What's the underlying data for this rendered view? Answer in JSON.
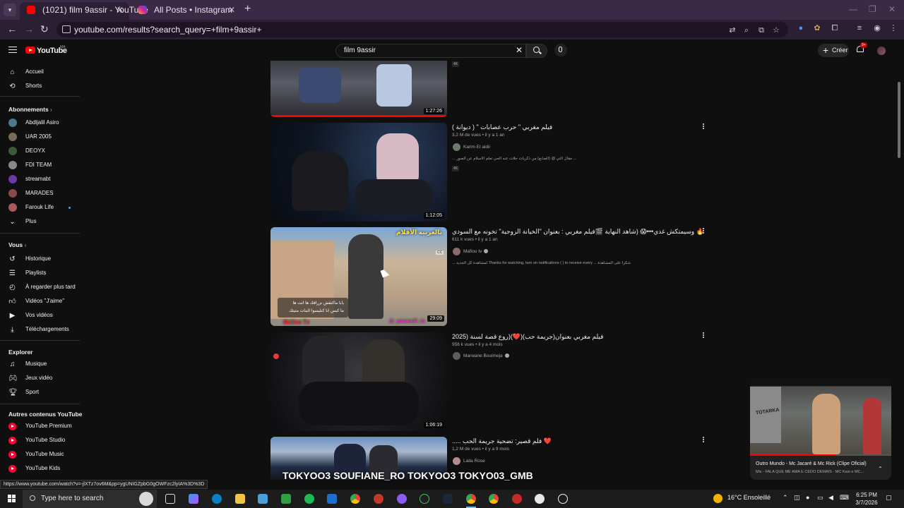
{
  "browser": {
    "tabs": [
      {
        "title": "(1021) film 9assir - YouTube",
        "favicon": "youtube-icon",
        "active": true
      },
      {
        "title": "All Posts • Instagram",
        "favicon": "instagram-icon",
        "active": false
      }
    ],
    "url": "youtube.com/results?search_query=+film+9assir+"
  },
  "youtube": {
    "logo_text": "YouTube",
    "region": "MA",
    "search_query": "film 9assir",
    "create_label": "Créer",
    "notification_count": "9+"
  },
  "sidebar": {
    "main": [
      {
        "label": "Accueil",
        "icon": "home-icon"
      },
      {
        "label": "Shorts",
        "icon": "shorts-icon"
      }
    ],
    "subscriptions_title": "Abonnements",
    "subscriptions": [
      {
        "label": "Abdljalil Asiro",
        "color": "#4a7a8c"
      },
      {
        "label": "UAR 2005",
        "color": "#7a6a5a"
      },
      {
        "label": "DEOYX",
        "color": "#3a5a3a"
      },
      {
        "label": "FDI TEAM",
        "color": "#888888"
      },
      {
        "label": "streamabt",
        "color": "#6a3aa8"
      },
      {
        "label": "MARADES",
        "color": "#8a4a4a"
      },
      {
        "label": "Farouk Life",
        "color": "#a85a5a"
      },
      {
        "label": "Plus",
        "color": ""
      }
    ],
    "you_title": "Vous",
    "you": [
      {
        "label": "Historique",
        "icon": "history-icon"
      },
      {
        "label": "Playlists",
        "icon": "playlist-icon"
      },
      {
        "label": "À regarder plus tard",
        "icon": "clock-icon"
      },
      {
        "label": "Vidéos \"J'aime\"",
        "icon": "like-icon"
      },
      {
        "label": "Vos vidéos",
        "icon": "video-icon"
      },
      {
        "label": "Téléchargements",
        "icon": "download-icon"
      }
    ],
    "explore_title": "Explorer",
    "explore": [
      {
        "label": "Musique",
        "icon": "music-icon"
      },
      {
        "label": "Jeux vidéo",
        "icon": "gamepad-icon"
      },
      {
        "label": "Sport",
        "icon": "trophy-icon"
      }
    ],
    "more_title": "Autres contenus YouTube",
    "more": [
      {
        "label": "YouTube Premium"
      },
      {
        "label": "YouTube Studio"
      },
      {
        "label": "YouTube Music"
      },
      {
        "label": "YouTube Kids"
      }
    ]
  },
  "results": [
    {
      "duration": "1:27:26",
      "badge": "4K"
    },
    {
      "title": "فيلم مغربي \" حرب عصابات \" ( ديوانة )",
      "meta": "3,2 M de vues • il y a 1 an",
      "channel": "Karim El aidii",
      "desc": "... مقال التي @ (الصانع) من ذكريات حلات عنه الحي تعلم الاسلام عن الصور ... ",
      "badge": "4K",
      "duration": "1:12:05"
    },
    {
      "title": "🔥 وسيمتكش غدي•••😱 (شاهد النهاية 🎬فيلم مغربي : بعنوان \"الخيانة الزوجية\" تخونه مع السودي",
      "meta": "611 k vues • il y a 1 an",
      "channel": "Mafiou tv",
      "desc": "... لمشاهدة كل الجديد Thanks for watching, turn on notifications ( ) to receive every ... شكرا على المشاهدة",
      "duration": "29:09",
      "overlay_top": "بالعربية الأفلام",
      "overlay_sub": "بابا ماكنقش نزرافك ها انت ها",
      "overlay_sub2": "ما كبس انا كنليسوا البنات متيتك",
      "overlay_left": "Mafiou Tv",
      "overlay_right": "@_yousoufi_ro"
    },
    {
      "title": "فيلم مغربي بعنوان(جريمة حب)(❤️)(روع قصة لسنة (2025",
      "meta": "956 k vues • il y a 4 mois",
      "channel": "Marwane Bouimeja",
      "duration": "1:06:19"
    },
    {
      "title": "❤️ فلم قصير: تضحية جريمة الحب .....",
      "meta": "1,2 M de vues • il y a 9 mois",
      "channel": "Laila Rose",
      "overlay": "TOKYOO3 SOUFIANE_RO TOKYOO3 TOKYO03_GMB"
    }
  ],
  "miniplayer": {
    "title": "Outro Mundo - Mc Jacaré & Mc Rick (Clipe Oficial)",
    "subtitle": "Mix - FALA QUE ME AMA É CEDO DEMAIS - MC Kaio e MC...",
    "progress": 0.61,
    "overlay": "TOTARKA"
  },
  "status_url": "https://www.youtube.com/watch?v=-jlXTz7ov6M&pp=ygUNIGZpbG0gOWFzc2lyIA%3D%3D",
  "taskbar": {
    "search_placeholder": "Type here to search",
    "weather": "16°C Ensoleillé",
    "time": "6:25 PM",
    "date": "3/7/2026"
  }
}
